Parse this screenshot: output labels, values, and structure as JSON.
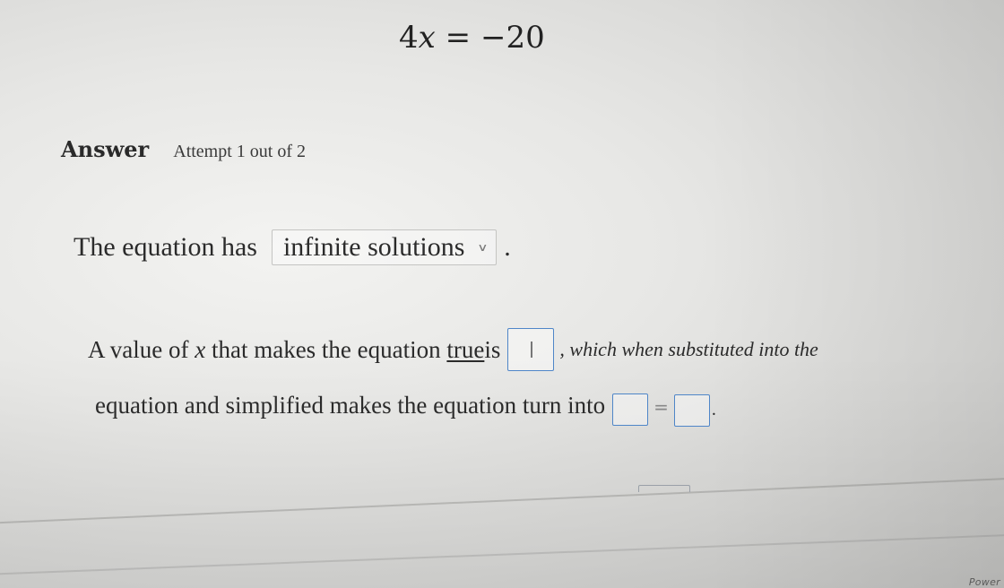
{
  "equation": {
    "coefficient": "4",
    "variable": "x",
    "operator": "=",
    "rhs": "−20"
  },
  "answer": {
    "label": "Answer",
    "attempt": "Attempt 1 out of 2"
  },
  "sentence1": {
    "prefix": "The equation has",
    "dropdown_value": "infinite solutions",
    "suffix": "."
  },
  "sentence2": {
    "part1": "A value of ",
    "variable": "x",
    "part2": " that makes the equation ",
    "underlined": "true",
    "part3": " is",
    "after_box": ", which when substituted into the"
  },
  "sentence3": {
    "part1": "equation and simplified makes the equation turn into",
    "equals": "=",
    "end": "."
  },
  "footer": {
    "brand": "Power"
  },
  "colors": {
    "input_border": "#4f86c8",
    "text": "#2b2b2b"
  }
}
